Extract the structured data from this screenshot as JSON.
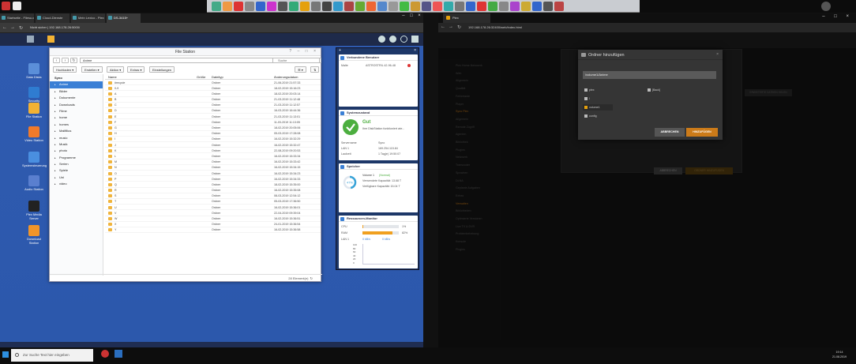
{
  "taskbar": {
    "search_placeholder": "Zur Suche Text hier eingeben",
    "time": "19:14",
    "date": "21.08.2019"
  },
  "left_browser": {
    "tabs": [
      {
        "label": "Startseite - Filesu.com",
        "active": false
      },
      {
        "label": "Cloud-Dienste",
        "active": false
      },
      {
        "label": "Mein Lexico - Plex Forum",
        "active": false
      },
      {
        "label": "DS-3415+",
        "active": true
      }
    ],
    "address": "Nicht sicher | 192.168.178.26:5000/"
  },
  "desktop_icons": [
    {
      "label": "Data Disks",
      "color": "#5b8fd9"
    },
    {
      "label": "Security",
      "color": "#2f7cd1"
    },
    {
      "label": "File Station",
      "color": "#f2b233"
    },
    {
      "label": "Video Station",
      "color": "#f07a2b"
    },
    {
      "label": "Systemsteuerung",
      "color": "#4a8fe0"
    },
    {
      "label": "Audio Station",
      "color": "#5a7fcf"
    },
    {
      "label": "Plex Media Server",
      "color": "#222222"
    },
    {
      "label": "Download Station",
      "color": "#f0952a"
    }
  ],
  "file_station": {
    "title": "File Station",
    "path": "Anime",
    "search_placeholder": "Suche",
    "toolbar": [
      "Hochladen",
      "Erstellen",
      "Aktion",
      "Extras",
      "Einstellungen"
    ],
    "columns": [
      "Name",
      "Größe",
      "Dateityp",
      "Änderungsdatum"
    ],
    "tree_root": "Syno",
    "tree": [
      "Anime",
      "Bilder",
      "Dokumente",
      "Downloads",
      "Filme",
      "home",
      "homes",
      "Mailfilius",
      "music",
      "Musik",
      "photo",
      "Programme",
      "Serien",
      "Spiele",
      "Uni",
      "video"
    ],
    "tree_selected": "Anime",
    "rows": [
      [
        "#recycle",
        "Ordner",
        "21-06-2019 21:57:33"
      ],
      [
        "0-9",
        "Ordner",
        "18-02-2019 15:16:23"
      ],
      [
        "A",
        "Ordner",
        "18-02-2019 20:03:14"
      ],
      [
        "B",
        "Ordner",
        "21-03-2019 11:12:48"
      ],
      [
        "C",
        "Ordner",
        "21-03-2019 11:12:57"
      ],
      [
        "D",
        "Ordner",
        "16-03-2019 16:44:36"
      ],
      [
        "E",
        "Ordner",
        "21-03-2019 11:13:01"
      ],
      [
        "F",
        "Ordner",
        "11-03-2019 11:13:05"
      ],
      [
        "G",
        "Ordner",
        "18-02-2019 20:05:06"
      ],
      [
        "H",
        "Ordner",
        "05-03-2019 17:28:08"
      ],
      [
        "I",
        "Ordner",
        "16-02-2019 15:32:29"
      ],
      [
        "J",
        "Ordner",
        "16-02-2019 15:32:47"
      ],
      [
        "K",
        "Ordner",
        "22-08-2019 09:20:53"
      ],
      [
        "L",
        "Ordner",
        "16-02-2019 15:33:34"
      ],
      [
        "M",
        "Ordner",
        "16-02-2019 15:33:42"
      ],
      [
        "N",
        "Ordner",
        "16-02-2019 15:34:15"
      ],
      [
        "O",
        "Ordner",
        "16-02-2019 15:34:23"
      ],
      [
        "P",
        "Ordner",
        "16-02-2019 15:34:33"
      ],
      [
        "Q",
        "Ordner",
        "18-02-2019 15:35:00"
      ],
      [
        "R",
        "Ordner",
        "16-02-2019 15:35:08"
      ],
      [
        "S",
        "Ordner",
        "08-03-2019 12:54:12"
      ],
      [
        "T",
        "Ordner",
        "05-03-2019 17:36:50"
      ],
      [
        "U",
        "Ordner",
        "16-02-2019 15:36:01"
      ],
      [
        "V",
        "Ordner",
        "22-04-2019 09:39:04"
      ],
      [
        "W",
        "Ordner",
        "16-02-2019 15:36:51"
      ],
      [
        "X",
        "Ordner",
        "24-01-2019 15:36:54"
      ],
      [
        "Y",
        "Ordner",
        "16-02-2019 15:36:58"
      ]
    ],
    "footer": "28 Element(e)"
  },
  "widgets": {
    "users_title": "Verbundene Benutzer",
    "user_name": "Malte",
    "user_detail": "ASTROSTRIL 42-96-48",
    "health_title": "Systemzustand",
    "health_status": "Gut",
    "health_desc": "Ihre DiskStation funktioniert wie...",
    "health_rows": [
      {
        "k": "Servername",
        "v": "Syno"
      },
      {
        "k": "LAN 1",
        "v": "169.254.115.84"
      },
      {
        "k": "Laufzeit",
        "v": "1 Tag(e) 19:50:07"
      }
    ],
    "storage_title": "Speicher",
    "volume_name": "Volume 1",
    "volume_state": "(Normal)",
    "volume_percent": 47,
    "volume_used": "Verwendete Kapazität: 13.68 T",
    "volume_free": "Verfügbare Kapazität: 15.04 T",
    "resmon_title": "Ressourcen-Monitor",
    "cpu_label": "CPU",
    "cpu_pct": 1,
    "cpu_text": "1%",
    "ram_label": "RAM",
    "ram_pct": 82,
    "ram_text": "82%",
    "lan_label": "LAN 1",
    "lan_up": "0 kB/s",
    "lan_down": "0 kB/s",
    "chart_ticks": [
      "100",
      "80",
      "60",
      "40",
      "20",
      "0"
    ]
  },
  "right_browser": {
    "tab_label": "Plex",
    "address": "192.168.178.26:32400/web/index.html",
    "sidebar": [
      "Plex Home-Netzwerk",
      "Web",
      "Allgemein",
      "Qualität",
      "Fehlertaste",
      "Player",
      "Syno Plex",
      "Allgemein",
      "Remote Zugriff",
      "Agenten",
      "Bibliothek",
      "Plugins",
      "Netzwerk",
      "Transcoder",
      "Sprachen",
      "DLNA",
      "Geplante Aufgaben",
      "Extras",
      "Verwalten",
      "Bibliotheken",
      "Optimierte Versionen",
      "Live TV & DVR",
      "Problembehebung",
      "Konsole",
      "Plugins"
    ],
    "bg_buttons": [
      "ABBRECHEN",
      "ORDNER HINZUFÜGEN"
    ],
    "bg_right_button": "ERWEITERTE DATEIEN HOLEN"
  },
  "dialog": {
    "title": "Ordner hinzufügen",
    "path": "/volume1/Anime",
    "items_left": [
      "plex",
      "/",
      "volume1",
      "config"
    ],
    "item_right": "[Back]",
    "selected": "volume1",
    "cancel": "ABBRECHEN",
    "confirm": "HINZUFÜGEN",
    "accent": "#e5a00d"
  }
}
